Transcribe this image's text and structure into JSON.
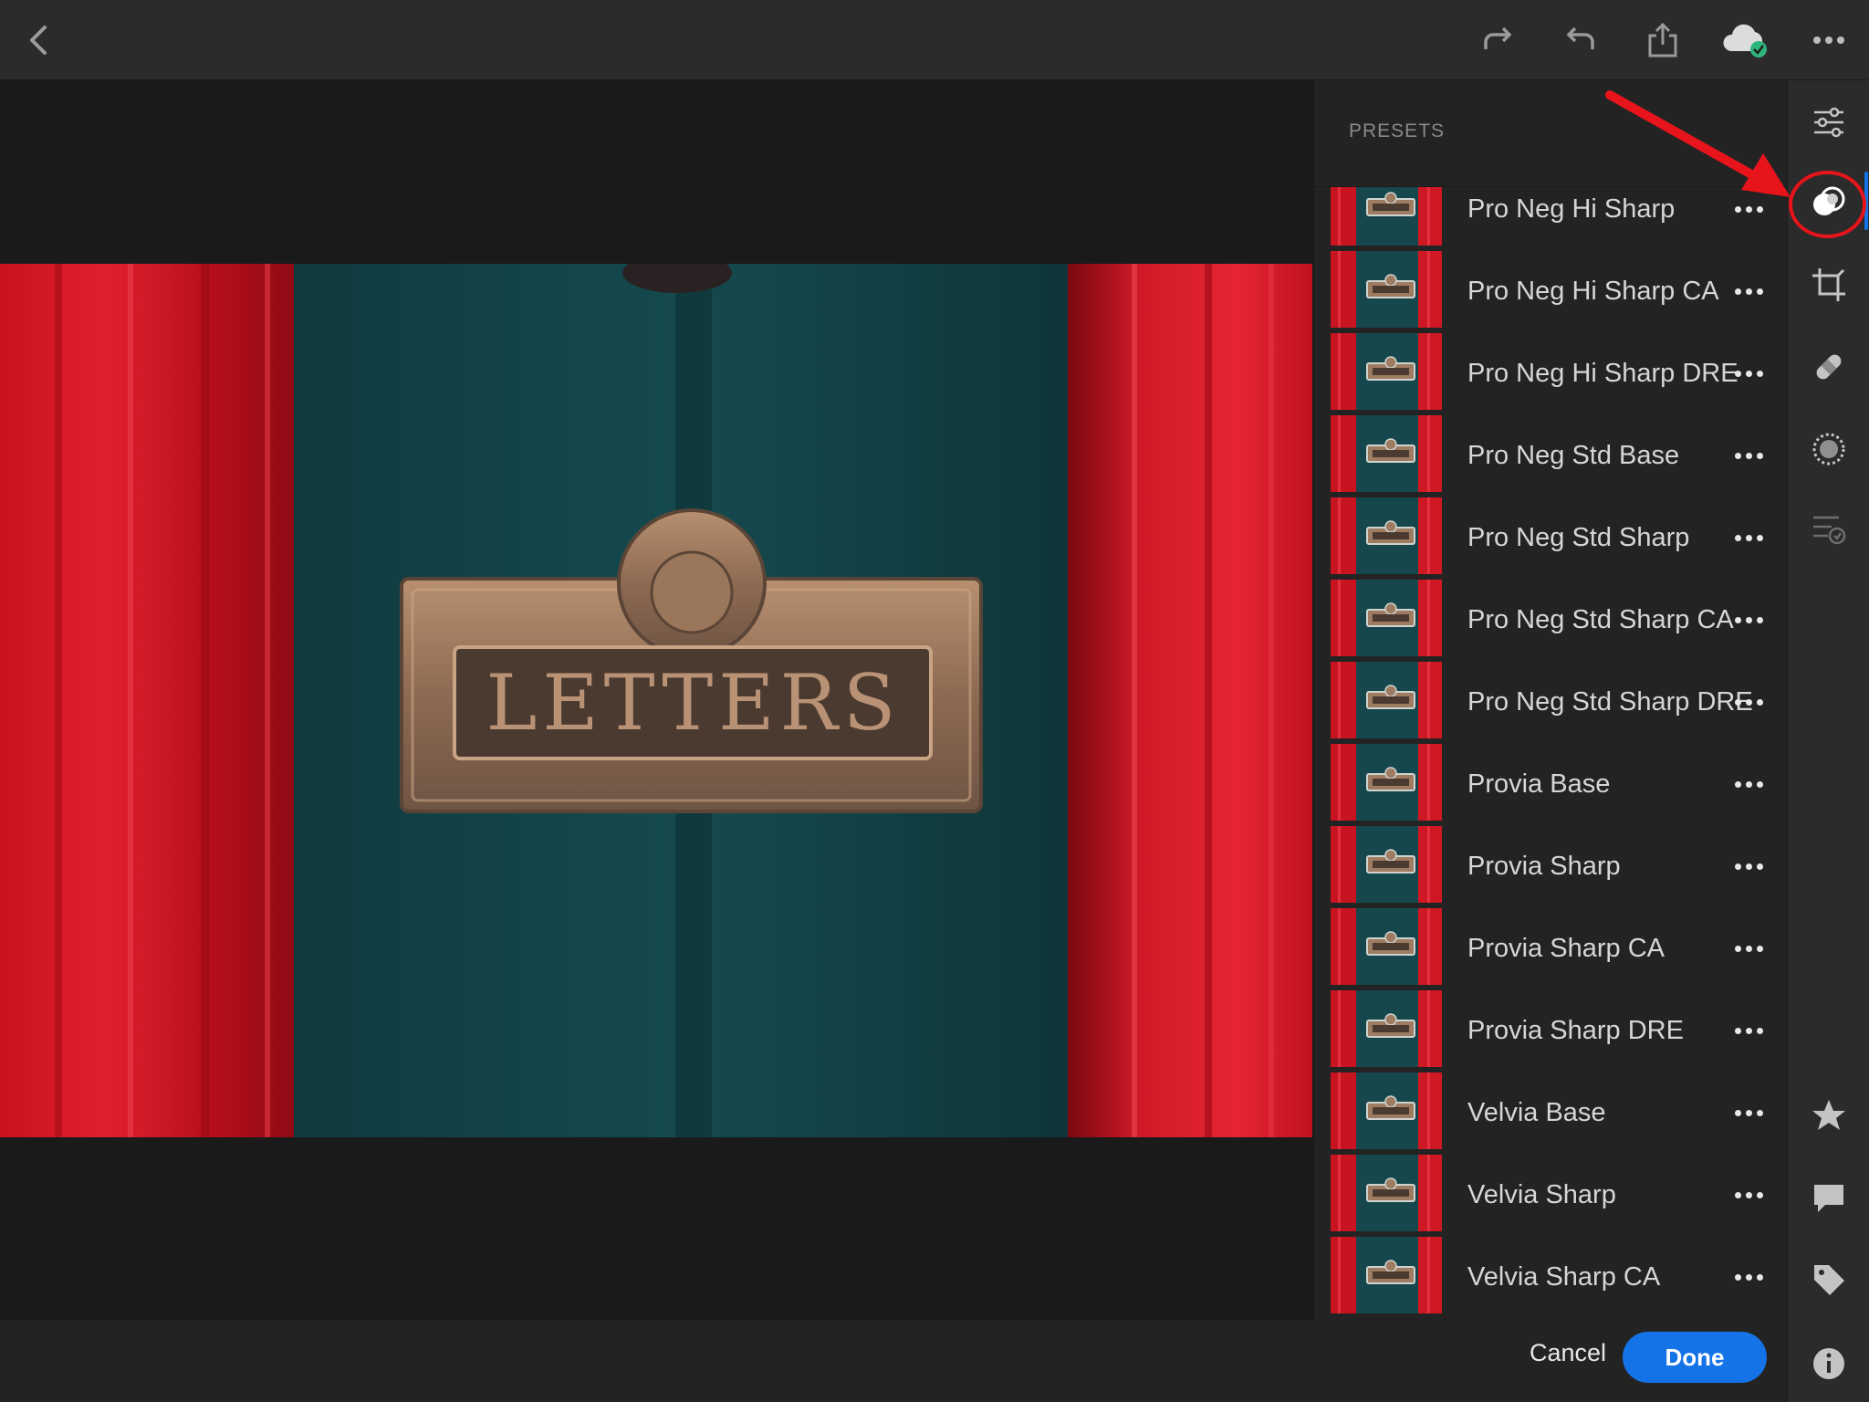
{
  "panel": {
    "title": "PRESETS",
    "presets": [
      "Pro Neg Hi Sharp",
      "Pro Neg Hi Sharp CA",
      "Pro Neg Hi Sharp DRE",
      "Pro Neg Std Base",
      "Pro Neg Std Sharp",
      "Pro Neg Std Sharp CA",
      "Pro Neg Std Sharp DRE",
      "Provia Base",
      "Provia Sharp",
      "Provia Sharp CA",
      "Provia Sharp DRE",
      "Velvia Base",
      "Velvia Sharp",
      "Velvia Sharp CA"
    ],
    "cancel_label": "Cancel",
    "done_label": "Done"
  },
  "photo": {
    "plate_text": "LETTERS"
  },
  "topbar": {
    "icons": [
      "back-icon",
      "redo-icon",
      "undo-icon",
      "share-icon",
      "cloud-synced-icon",
      "more-icon"
    ]
  },
  "rail": {
    "icons": [
      "edit-sliders-icon",
      "presets-icon",
      "crop-icon",
      "healing-icon",
      "masking-icon",
      "versions-icon",
      "rating-star-icon",
      "comment-icon",
      "tag-icon",
      "info-icon"
    ],
    "active": "presets-icon"
  },
  "colors": {
    "accent": "#1473e6",
    "annotation": "#e8141b",
    "cloud_ok": "#2fb67c"
  }
}
